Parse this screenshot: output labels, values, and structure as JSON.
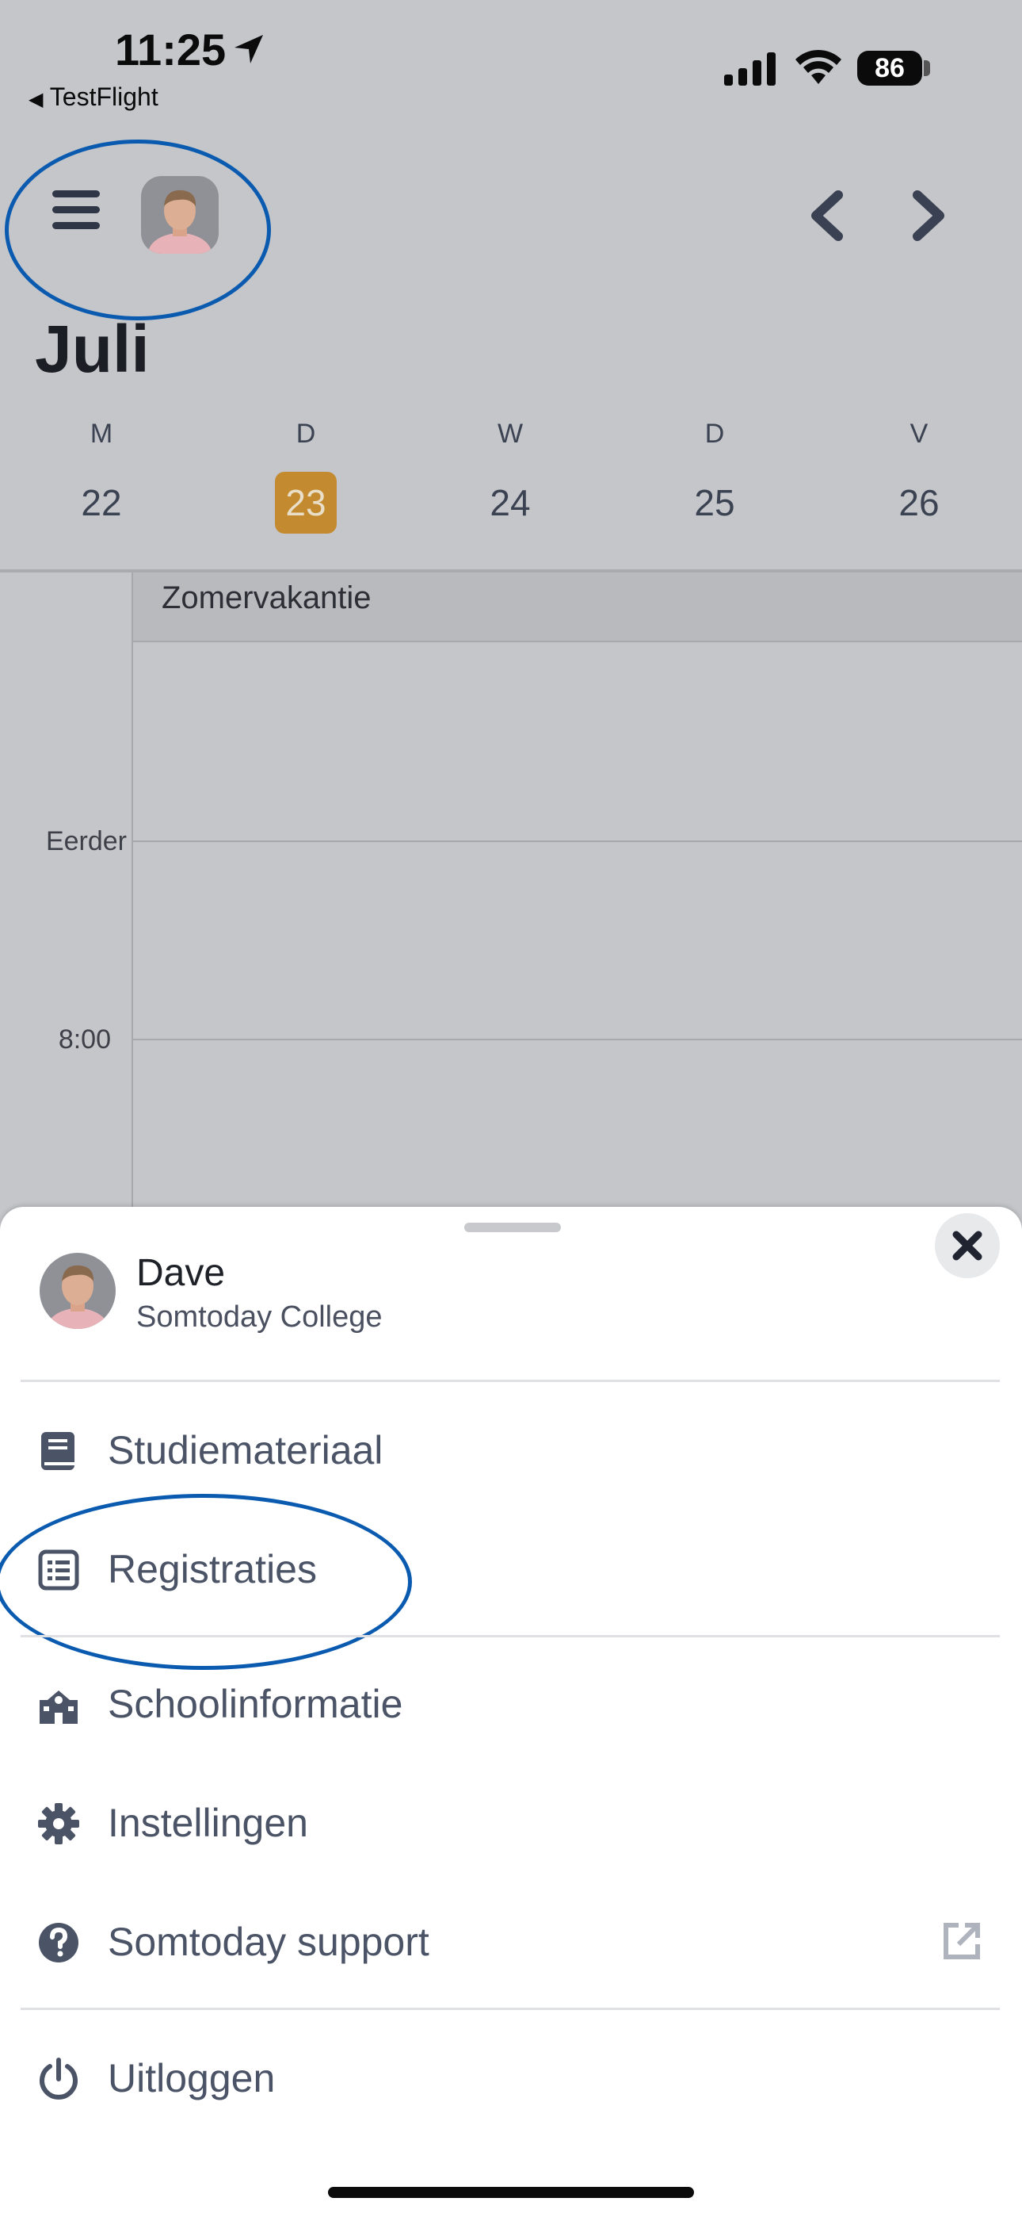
{
  "status": {
    "time": "11:25",
    "back_app": "TestFlight",
    "battery": "86"
  },
  "header": {
    "month": "Juli",
    "days": [
      {
        "letter": "M",
        "num": "22",
        "today": false
      },
      {
        "letter": "D",
        "num": "23",
        "today": true
      },
      {
        "letter": "W",
        "num": "24",
        "today": false
      },
      {
        "letter": "D",
        "num": "25",
        "today": false
      },
      {
        "letter": "V",
        "num": "26",
        "today": false
      }
    ]
  },
  "calendar": {
    "allday_event": "Zomervakantie",
    "time_labels": [
      "Eerder",
      "8:00"
    ]
  },
  "sheet": {
    "user_name": "Dave",
    "school": "Somtoday College",
    "items": [
      {
        "label": "Studiemateriaal",
        "icon": "book-icon"
      },
      {
        "label": "Registraties",
        "icon": "list-icon"
      },
      {
        "label": "Schoolinformatie",
        "icon": "school-icon"
      },
      {
        "label": "Instellingen",
        "icon": "gear-icon"
      },
      {
        "label": "Somtoday support",
        "icon": "help-icon"
      },
      {
        "label": "Uitloggen",
        "icon": "power-icon"
      }
    ]
  },
  "colors": {
    "accent": "#c48a2f",
    "annotation": "#0a5bb0",
    "menu_text": "#4b5366"
  }
}
